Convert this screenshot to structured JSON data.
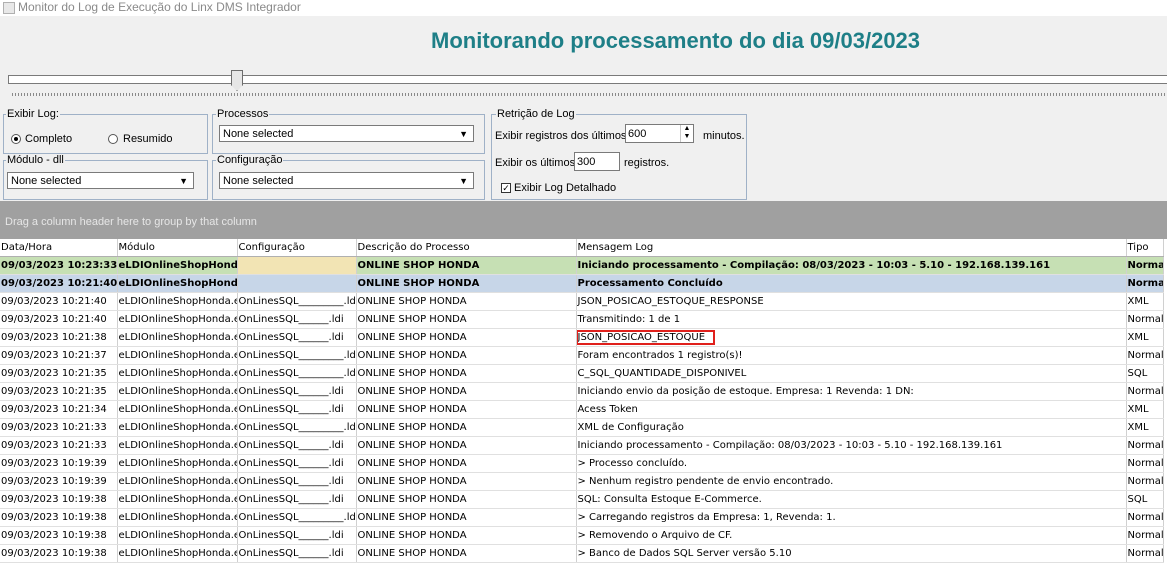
{
  "window": {
    "title": "Monitor do Log de Execução do Linx DMS Integrador"
  },
  "header": {
    "title": "Monitorando processamento do dia 09/03/2023"
  },
  "filters": {
    "exibir_log": {
      "label": "Exibir Log:",
      "option_full": "Completo",
      "option_summary": "Resumido",
      "selected": "Completo"
    },
    "processos": {
      "label": "Processos",
      "value": "None selected"
    },
    "modulo": {
      "label": "Módulo - dll",
      "value": "None selected"
    },
    "configuracao": {
      "label": "Configuração",
      "value": "None selected"
    },
    "retricao": {
      "label": "Retrição de Log",
      "minutes_prefix": "Exibir registros dos últimos",
      "minutes_value": "600",
      "minutes_suffix": "minutos.",
      "records_prefix": "Exibir os últimos",
      "records_value": "300",
      "records_suffix": "registros.",
      "detailed_label": "Exibir Log Detalhado",
      "detailed_checked": true
    }
  },
  "group_panel": {
    "hint": "Drag a column header here to group by that column"
  },
  "grid": {
    "columns": [
      "Data/Hora",
      "Módulo",
      "Configuração",
      "Descrição do Processo",
      "Mensagem Log",
      "Tipo"
    ],
    "rows": [
      {
        "style": "green",
        "cells": [
          "09/03/2023 10:23:33",
          "eLDIOnlineShopHonda",
          "",
          "ONLINE SHOP HONDA",
          "Iniciando processamento - Compilação: 08/03/2023 - 10:03 - 5.10 - 192.168.139.161",
          "Normal"
        ]
      },
      {
        "style": "blue",
        "cells": [
          "09/03/2023 10:21:40",
          "eLDIOnlineShopHonda",
          "",
          "ONLINE SHOP HONDA",
          "Processamento Concluído",
          "Normal"
        ]
      },
      {
        "style": "",
        "cells": [
          "09/03/2023 10:21:40",
          "eLDIOnlineShopHonda.exe",
          "OnLinesSQL_________.ldi",
          "ONLINE SHOP HONDA",
          "JSON_POSICAO_ESTOQUE_RESPONSE",
          "XML"
        ]
      },
      {
        "style": "",
        "cells": [
          "09/03/2023 10:21:40",
          "eLDIOnlineShopHonda.exe",
          "OnLinesSQL______.ldi",
          "ONLINE SHOP HONDA",
          "Transmitindo: 1 de 1",
          "Normal"
        ]
      },
      {
        "style": "",
        "cells": [
          "09/03/2023 10:21:38",
          "eLDIOnlineShopHonda.exe",
          "OnLinesSQL______.ldi",
          "ONLINE SHOP HONDA",
          "JSON_POSICAO_ESTOQUE",
          "XML",
          "highlight"
        ]
      },
      {
        "style": "",
        "cells": [
          "09/03/2023 10:21:37",
          "eLDIOnlineShopHonda.exe",
          "OnLinesSQL_________.ldi",
          "ONLINE SHOP HONDA",
          "Foram encontrados 1 registro(s)!",
          "Normal"
        ]
      },
      {
        "style": "",
        "cells": [
          "09/03/2023 10:21:35",
          "eLDIOnlineShopHonda.exe",
          "OnLinesSQL_________.ldi",
          "ONLINE SHOP HONDA",
          "C_SQL_QUANTIDADE_DISPONIVEL",
          "SQL"
        ]
      },
      {
        "style": "",
        "cells": [
          "09/03/2023 10:21:35",
          "eLDIOnlineShopHonda.exe",
          "OnLinesSQL______.ldi",
          "ONLINE SHOP HONDA",
          "Iniciando envio da posição de estoque. Empresa: 1 Revenda: 1 DN:",
          "Normal"
        ]
      },
      {
        "style": "",
        "cells": [
          "09/03/2023 10:21:34",
          "eLDIOnlineShopHonda.exe",
          "OnLinesSQL______.ldi",
          "ONLINE SHOP HONDA",
          "Acess Token",
          "XML"
        ]
      },
      {
        "style": "",
        "cells": [
          "09/03/2023 10:21:33",
          "eLDIOnlineShopHonda.exe",
          "OnLinesSQL_________.ldi",
          "ONLINE SHOP HONDA",
          "XML de Configuração",
          "XML"
        ]
      },
      {
        "style": "",
        "cells": [
          "09/03/2023 10:21:33",
          "eLDIOnlineShopHonda.exe",
          "OnLinesSQL______.ldi",
          "ONLINE SHOP HONDA",
          "Iniciando processamento - Compilação: 08/03/2023 - 10:03 - 5.10 - 192.168.139.161",
          "Normal"
        ]
      },
      {
        "style": "",
        "cells": [
          "09/03/2023 10:19:39",
          "eLDIOnlineShopHonda.exe",
          "OnLinesSQL______.ldi",
          "ONLINE SHOP HONDA",
          "  > Processo concluído.",
          "Normal"
        ]
      },
      {
        "style": "",
        "cells": [
          "09/03/2023 10:19:39",
          "eLDIOnlineShopHonda.exe",
          "OnLinesSQL______.ldi",
          "ONLINE SHOP HONDA",
          "  > Nenhum registro pendente de envio encontrado.",
          "Normal"
        ]
      },
      {
        "style": "",
        "cells": [
          "09/03/2023 10:19:38",
          "eLDIOnlineShopHonda.exe",
          "OnLinesSQL______.ldi",
          "ONLINE SHOP HONDA",
          "SQL: Consulta Estoque E-Commerce.",
          "SQL"
        ]
      },
      {
        "style": "",
        "cells": [
          "09/03/2023 10:19:38",
          "eLDIOnlineShopHonda.exe",
          "OnLinesSQL_________.ldi",
          "ONLINE SHOP HONDA",
          "  > Carregando registros da Empresa: 1, Revenda: 1.",
          "Normal"
        ]
      },
      {
        "style": "",
        "cells": [
          "09/03/2023 10:19:38",
          "eLDIOnlineShopHonda.exe",
          "OnLinesSQL______.ldi",
          "ONLINE SHOP HONDA",
          "  > Removendo o Arquivo de CF.",
          "Normal"
        ]
      },
      {
        "style": "",
        "cells": [
          "09/03/2023 10:19:38",
          "eLDIOnlineShopHonda.exe",
          "OnLinesSQL______.ldi",
          "ONLINE SHOP HONDA",
          "  > Banco de Dados SQL Server versão 5.10",
          "Normal"
        ]
      }
    ]
  },
  "colors": {
    "header_title": "#1e7f87",
    "row_start": "#c6e0b4",
    "row_done": "#c7d6e8",
    "highlight_box": "#e0201c"
  }
}
